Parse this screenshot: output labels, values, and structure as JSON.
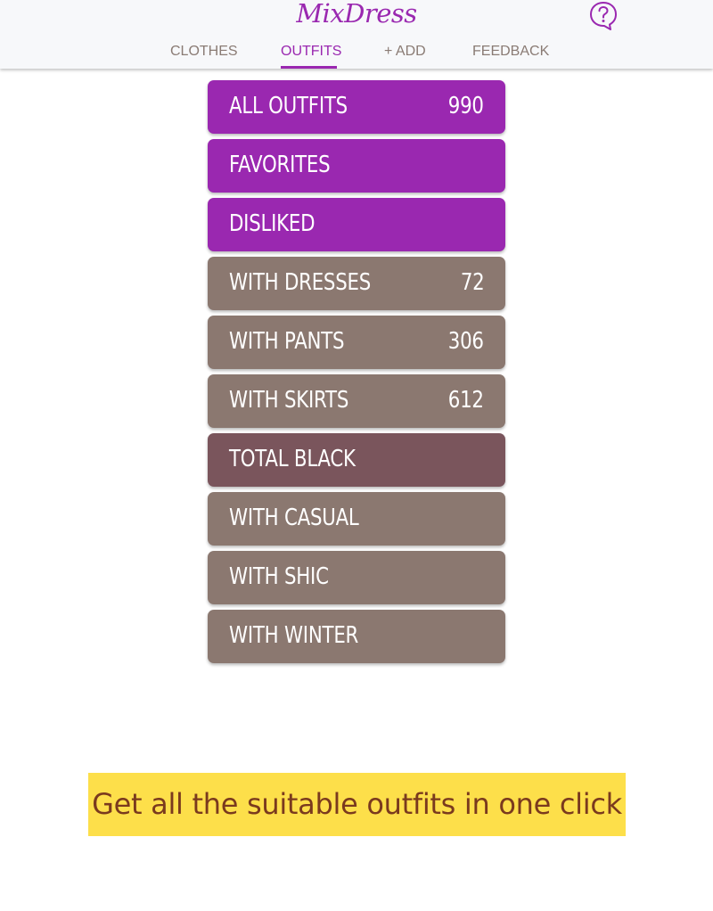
{
  "app": {
    "logo_text": "MixDress"
  },
  "header": {
    "help_icon": "question-bubble-icon",
    "tabs": [
      {
        "label": "CLOTHES",
        "active": false
      },
      {
        "label": "OUTFITS",
        "active": true
      },
      {
        "label": "+ ADD",
        "active": false
      },
      {
        "label": "FEEDBACK",
        "active": false
      }
    ]
  },
  "categories": [
    {
      "label": "All outfits",
      "count": "990",
      "color": "#9a28b0"
    },
    {
      "label": "Favorites",
      "count": "",
      "color": "#9a28b0"
    },
    {
      "label": "Disliked",
      "count": "",
      "color": "#9a28b0"
    },
    {
      "label": "With dresses",
      "count": "72",
      "color": "#8b7870"
    },
    {
      "label": "With pants",
      "count": "306",
      "color": "#8b7870"
    },
    {
      "label": "With skirts",
      "count": "612",
      "color": "#8b7870"
    },
    {
      "label": "Total black",
      "count": "",
      "color": "#7a555c"
    },
    {
      "label": "With casual",
      "count": "",
      "color": "#8b7870"
    },
    {
      "label": "With shic",
      "count": "",
      "color": "#8b7870"
    },
    {
      "label": "With winter",
      "count": "",
      "color": "#8b7870"
    }
  ],
  "banner": {
    "text": "Get all the suitable outfits in one click",
    "background": "#fddf4a",
    "text_color": "#7a3a1e"
  },
  "colors": {
    "accent": "#9a28b0",
    "nav_inactive": "#8a7b74"
  }
}
